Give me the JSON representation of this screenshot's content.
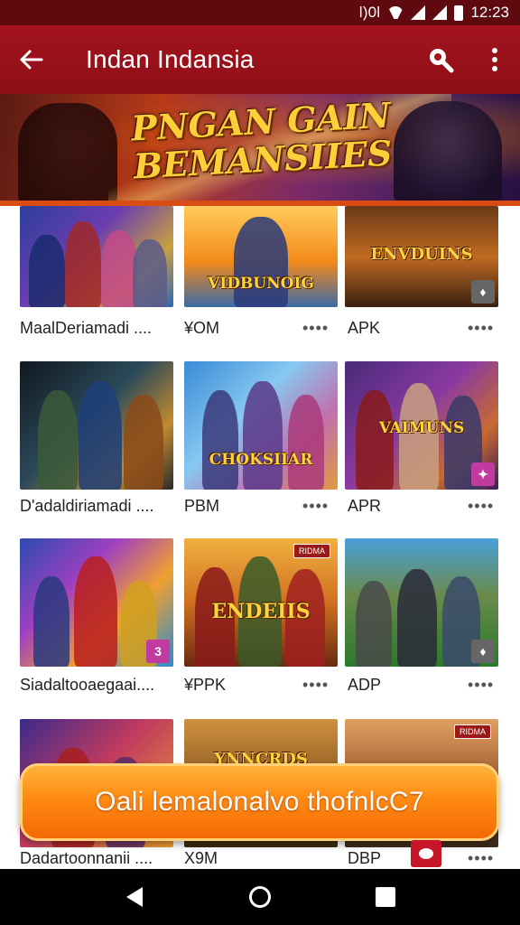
{
  "status_bar": {
    "time": "12:23",
    "indicator": "ǀ)0ǀ"
  },
  "app_bar": {
    "back_icon": "arrow-left-icon",
    "title": "Indan Indansia",
    "search_icon": "search-icon",
    "menu_icon": "more-vert-icon"
  },
  "banner": {
    "line1": "PNGAN GAIN",
    "line2": "BEMANSIIES"
  },
  "grid": {
    "rows": [
      {
        "captions": [
          "MaalDeriamadi ....",
          "¥OM",
          "APK"
        ],
        "dots": "••••",
        "thumb_labels": [
          "",
          "VIDBUNOIG",
          "ENVDUINS"
        ]
      },
      {
        "captions": [
          "D'adaldiriamadi ....",
          "PBM",
          "APR"
        ],
        "dots": "••••",
        "thumb_labels": [
          "",
          "CHOKSIIAR",
          "VAIMUNS"
        ]
      },
      {
        "captions": [
          "Siadaltooaegaai....",
          "¥PPK",
          "ADP"
        ],
        "dots": "••••",
        "thumb_labels": [
          "",
          "ENDEIIS",
          ""
        ]
      },
      {
        "captions": [
          "Dadartoonnanii ....",
          "X9M",
          "DBP"
        ],
        "dots": "••••",
        "thumb_labels": [
          "",
          "YNNCRDS",
          ""
        ]
      }
    ],
    "top_badge": "RIDMA"
  },
  "cta": {
    "label": "Oali lemalonalvo thofnlcC7"
  },
  "colors": {
    "status_bar": "#5e0a0f",
    "app_bar": "#a3131c",
    "cta": "#ff8a12",
    "banner_text": "#ffcf3a"
  },
  "nav_bar": {
    "back": "nav-back-icon",
    "home": "nav-home-icon",
    "recents": "nav-recents-icon"
  }
}
